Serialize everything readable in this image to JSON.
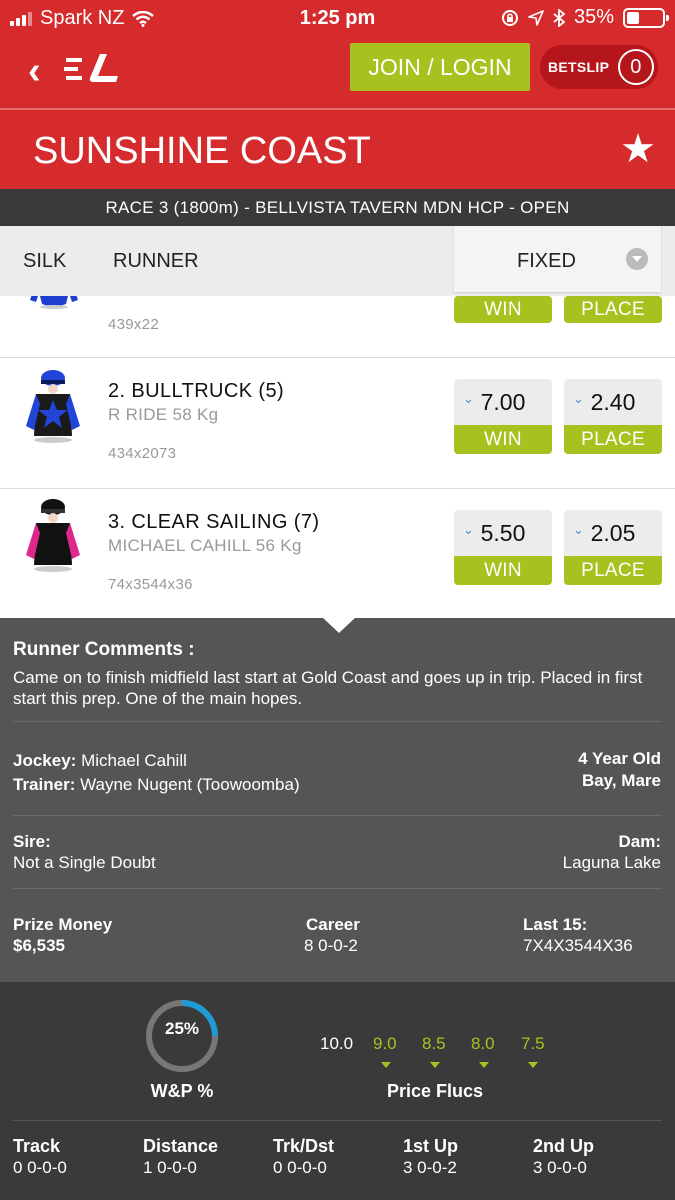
{
  "status_bar": {
    "carrier": "Spark NZ",
    "time": "1:25 pm",
    "battery": "35%",
    "battery_level": 0.35
  },
  "header": {
    "join_login": "JOIN / LOGIN",
    "betslip_label": "BETSLIP",
    "betslip_count": "0"
  },
  "venue": {
    "name": "SUNSHINE COAST"
  },
  "race": {
    "title": "RACE 3 (1800m) - BELLVISTA TAVERN MDN HCP - OPEN"
  },
  "columns": {
    "silk": "SILK",
    "runner": "RUNNER",
    "price_type": "FIXED"
  },
  "runners": [
    {
      "name": "",
      "jockey": "",
      "form": "439x22",
      "win": "",
      "place": "",
      "win_label": "WIN",
      "place_label": "PLACE"
    },
    {
      "name": "2. BULLTRUCK (5)",
      "jockey": "R RIDE 58 Kg",
      "form": "434x2073",
      "win": "7.00",
      "place": "2.40",
      "win_label": "WIN",
      "place_label": "PLACE"
    },
    {
      "name": "3. CLEAR SAILING (7)",
      "jockey": "MICHAEL CAHILL 56 Kg",
      "form": "74x3544x36",
      "win": "5.50",
      "place": "2.05",
      "win_label": "WIN",
      "place_label": "PLACE"
    }
  ],
  "comments": {
    "heading": "Runner Comments :",
    "text": "Came on to finish midfield last start at Gold Coast and goes up in trip. Placed in first start this prep. One of the main hopes.",
    "jockey_label": "Jockey:",
    "jockey": "Michael Cahill",
    "trainer_label": "Trainer:",
    "trainer": "Wayne Nugent (Toowoomba)",
    "age": "4 Year Old",
    "colour_sex": "Bay, Mare",
    "sire_label": "Sire:",
    "sire": "Not a Single Doubt",
    "dam_label": "Dam:",
    "dam": "Laguna Lake",
    "prize_label": "Prize Money",
    "prize": "$6,535",
    "career_label": "Career",
    "career": "8 0-0-2",
    "last15_label": "Last 15:",
    "last15": "7X4X3544X36"
  },
  "stats": {
    "wp_value": "25%",
    "wp_fraction": 0.25,
    "wp_label": "W&P %",
    "flucs_label": "Price Flucs",
    "flucs": [
      "10.0",
      "9.0",
      "8.5",
      "8.0",
      "7.5"
    ],
    "records": [
      {
        "label": "Track",
        "value": "0 0-0-0"
      },
      {
        "label": "Distance",
        "value": "1 0-0-0"
      },
      {
        "label": "Trk/Dst",
        "value": "0 0-0-0"
      },
      {
        "label": "1st Up",
        "value": "3 0-0-2"
      },
      {
        "label": "2nd Up",
        "value": "3 0-0-0"
      }
    ]
  },
  "colors": {
    "brand_red": "#d52b2d",
    "accent_green": "#a9c11f",
    "gauge_blue": "#1e9bd7"
  }
}
